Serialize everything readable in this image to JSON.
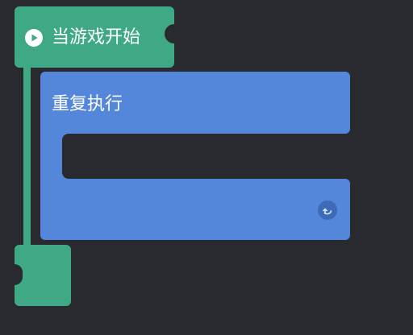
{
  "hat_block": {
    "label": "当游戏开始",
    "icon": "play-icon",
    "color": "#3fa985"
  },
  "repeat_block": {
    "label": "重复执行",
    "icon": "loop-arrow-icon",
    "color": "#5486d9"
  },
  "workspace": {
    "background": "#282a30"
  }
}
